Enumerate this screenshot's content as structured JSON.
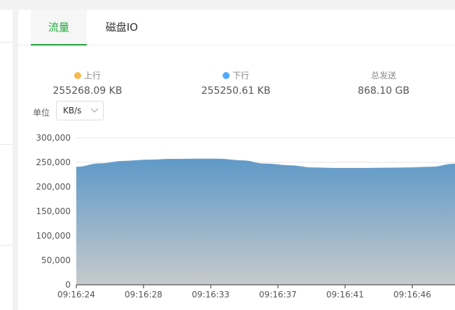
{
  "tabs": [
    {
      "label": "流量",
      "active": true
    },
    {
      "label": "磁盘IO",
      "active": false
    }
  ],
  "stats": [
    {
      "label": "上行",
      "value": "255268.09 KB",
      "dot_color": "#f7b851"
    },
    {
      "label": "下行",
      "value": "255250.61 KB",
      "dot_color": "#52a9ff"
    },
    {
      "label": "总发送",
      "value": "868.10 GB",
      "dot_color": null
    }
  ],
  "unit": {
    "label": "单位",
    "selected": "KB/s"
  },
  "colors": {
    "accent": "#20a53a",
    "area_top": "#5f99c8",
    "area_bottom": "#c6cacc"
  },
  "chart_data": {
    "type": "area",
    "x": [
      "09:16:24",
      "09:16:28",
      "09:16:33",
      "09:16:37",
      "09:16:41",
      "09:16:46"
    ],
    "series": [
      {
        "values": [
          240000,
          247000,
          252000,
          254500,
          256000,
          256500,
          256500,
          253000,
          246500,
          243000,
          238500,
          237500,
          237500,
          238000,
          238500,
          240000,
          246500
        ]
      }
    ],
    "ylim": [
      0,
      300000
    ],
    "yticks": [
      "0",
      "50,000",
      "100,000",
      "150,000",
      "200,000",
      "250,000",
      "300,000"
    ],
    "grid": true
  }
}
